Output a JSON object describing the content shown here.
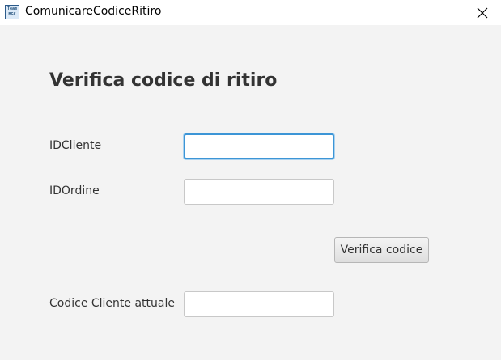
{
  "window": {
    "title": "ComunicareCodiceRitiro",
    "icon_text": "Team MGC"
  },
  "form": {
    "heading": "Verifica codice di ritiro",
    "id_cliente": {
      "label": "IDCliente",
      "value": ""
    },
    "id_ordine": {
      "label": "IDOrdine",
      "value": ""
    },
    "verify_button": "Verifica codice",
    "codice_cliente": {
      "label": "Codice Cliente attuale",
      "value": ""
    }
  },
  "colors": {
    "focus_border": "#3c95d6",
    "background": "#f3f3f3"
  }
}
